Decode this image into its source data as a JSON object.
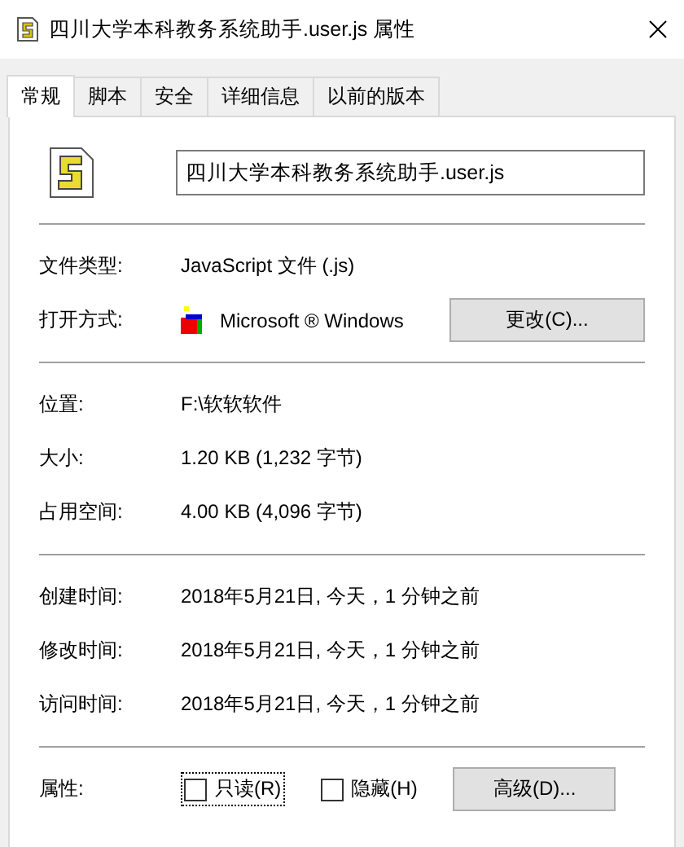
{
  "window": {
    "title": "四川大学本科教务系统助手.user.js 属性"
  },
  "tabs": [
    {
      "label": "常规",
      "selected": true
    },
    {
      "label": "脚本",
      "selected": false
    },
    {
      "label": "安全",
      "selected": false
    },
    {
      "label": "详细信息",
      "selected": false
    },
    {
      "label": "以前的版本",
      "selected": false
    }
  ],
  "file_name": "四川大学本科教务系统助手.user.js",
  "sections": [
    [
      {
        "kind": "text",
        "label": "文件类型:",
        "value": "JavaScript 文件 (.js)"
      },
      {
        "kind": "app",
        "label": "打开方式:",
        "value": "Microsoft ® Windows",
        "button": "更改(C)..."
      }
    ],
    [
      {
        "kind": "text",
        "label": "位置:",
        "value": "F:\\软软软件"
      },
      {
        "kind": "text",
        "label": "大小:",
        "value": "1.20 KB (1,232 字节)"
      },
      {
        "kind": "text",
        "label": "占用空间:",
        "value": "4.00 KB (4,096 字节)"
      }
    ],
    [
      {
        "kind": "text",
        "label": "创建时间:",
        "value": "2018年5月21日, 今天，1 分钟之前"
      },
      {
        "kind": "text",
        "label": "修改时间:",
        "value": "2018年5月21日, 今天，1 分钟之前"
      },
      {
        "kind": "text",
        "label": "访问时间:",
        "value": "2018年5月21日, 今天，1 分钟之前"
      }
    ]
  ],
  "attributes": {
    "label": "属性:",
    "checkboxes": [
      {
        "label": "只读(R)",
        "checked": false,
        "focused": true
      },
      {
        "label": "隐藏(H)",
        "checked": false,
        "focused": false
      }
    ],
    "button": "高级(D)..."
  }
}
